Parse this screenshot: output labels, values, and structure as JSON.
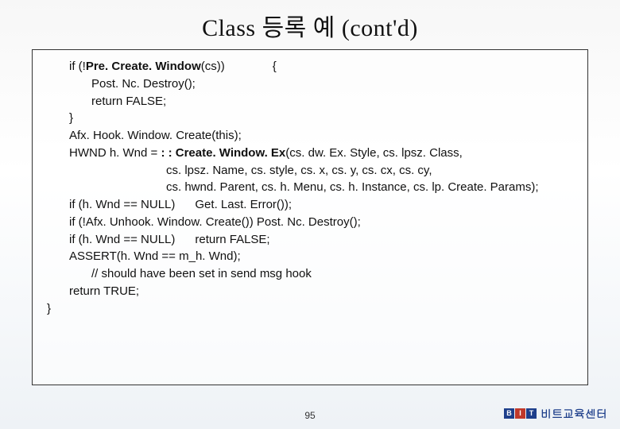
{
  "title": "Class 등록 예 (cont'd)",
  "code": {
    "l1a": "if (!",
    "l1b": "Pre. Create. Window",
    "l1c": "(cs))",
    "l1d": "{",
    "l2": "Post. Nc. Destroy();",
    "l3": "return FALSE;",
    "l4": "}",
    "l5": "Afx. Hook. Window. Create(this);",
    "l6a": "HWND h. Wnd = ",
    "l6b": ": : Create. Window. Ex",
    "l6c": "(cs. dw. Ex. Style, cs. lpsz. Class,",
    "l7": "cs. lpsz. Name, cs. style, cs. x, cs. y, cs. cx, cs. cy,",
    "l8": "cs. hwnd. Parent, cs. h. Menu, cs. h. Instance, cs. lp. Create. Params);",
    "l9": "if (h. Wnd == NULL)      Get. Last. Error());",
    "l10": "if (!Afx. Unhook. Window. Create()) Post. Nc. Destroy();",
    "l11": "if (h. Wnd == NULL)      return FALSE;",
    "l12": "ASSERT(h. Wnd == m_h. Wnd);",
    "l13": "// should have been set in send msg hook",
    "l14": "return TRUE;",
    "l15": "}"
  },
  "page_number": "95",
  "brand": {
    "logo_b": "B",
    "logo_i": "I",
    "logo_t": "T",
    "text": "비트교육센터"
  }
}
